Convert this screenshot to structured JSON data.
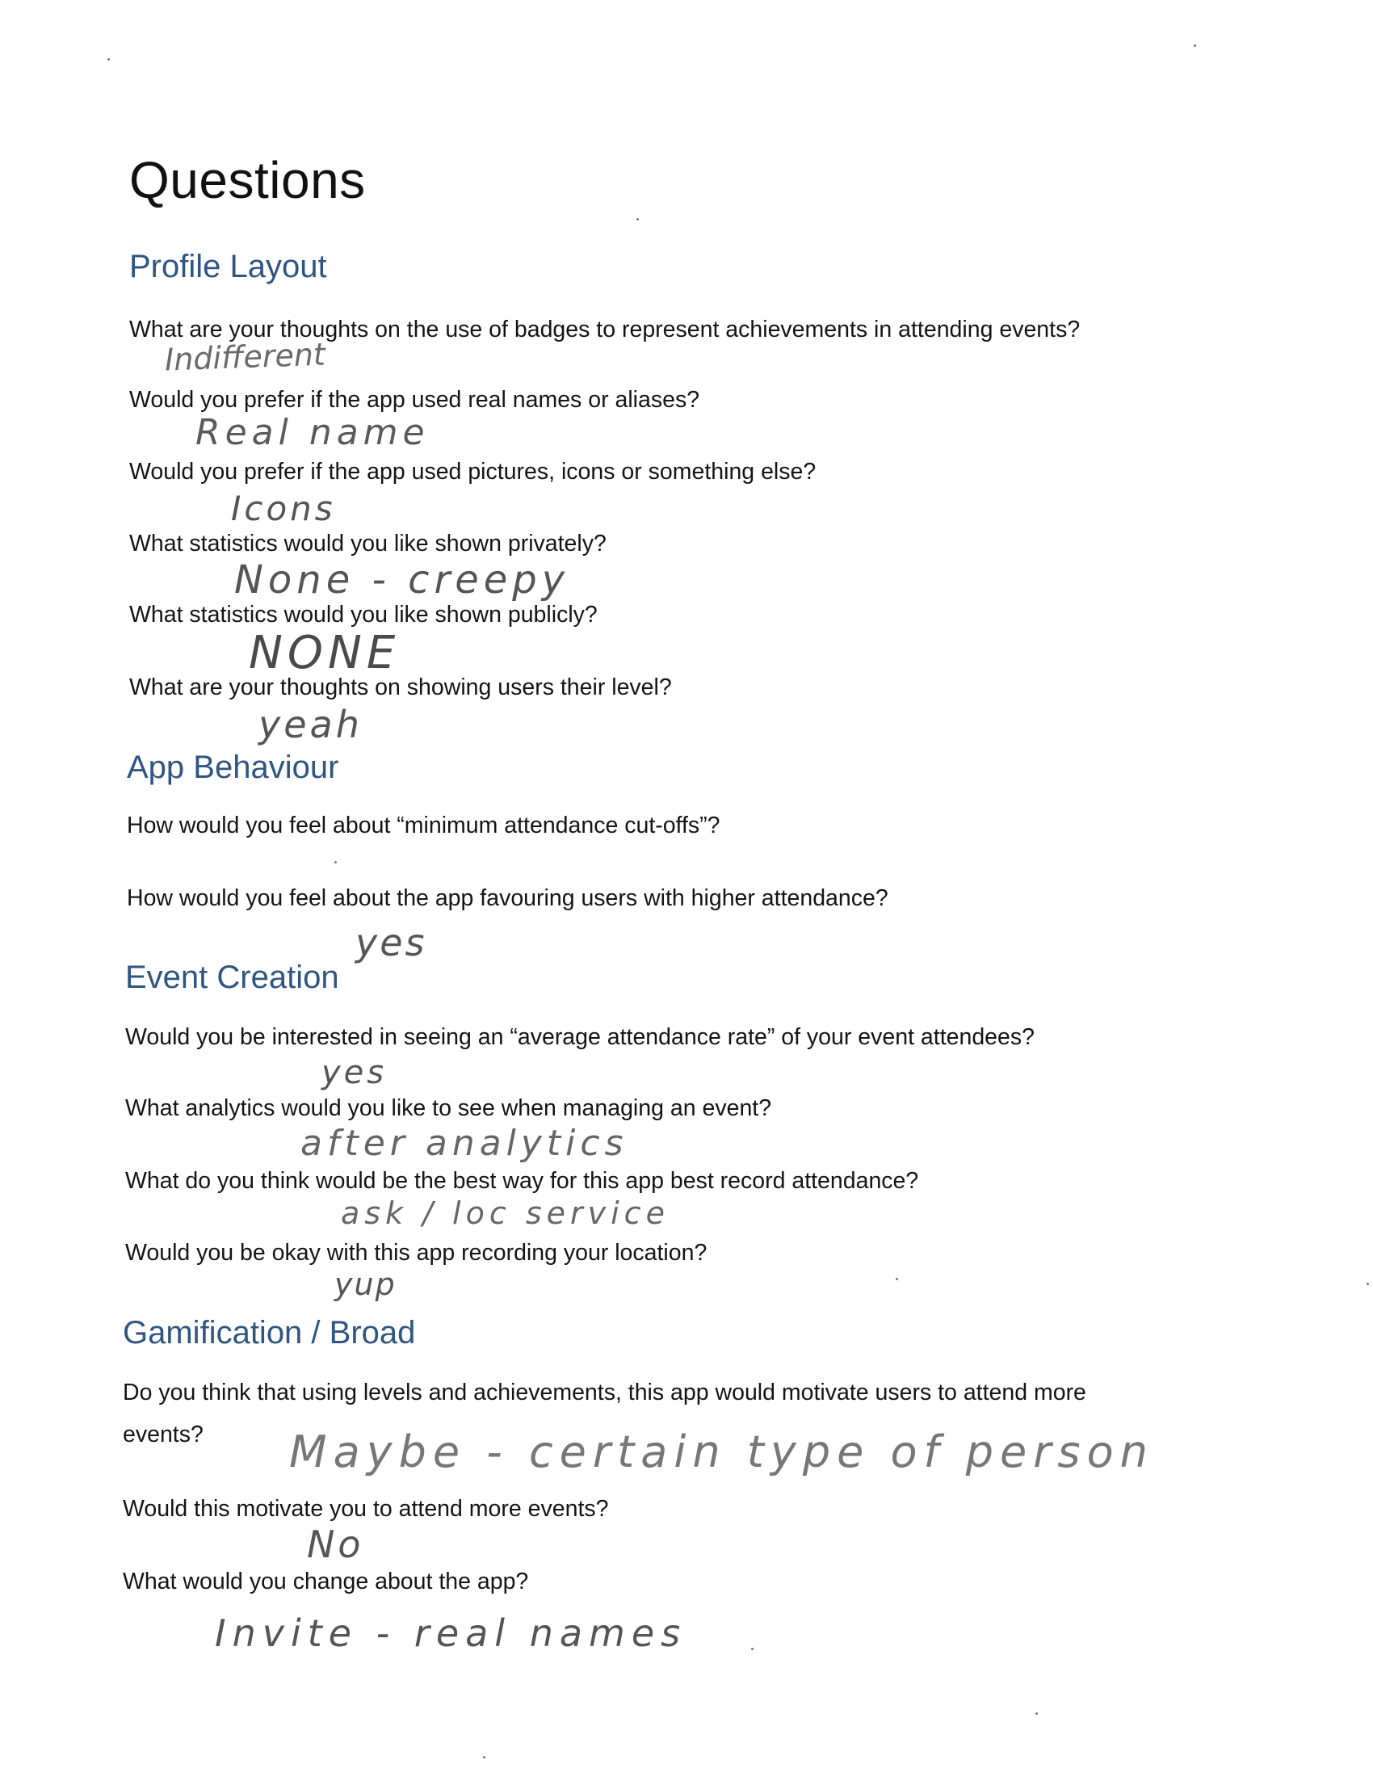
{
  "title": "Questions",
  "sections": [
    {
      "heading": "Profile Layout",
      "items": [
        {
          "q": "What are your thoughts on the use of badges to represent achievements in attending events?",
          "a": "Indifferent"
        },
        {
          "q": "Would you prefer if the app used real names or aliases?",
          "a": "Real name"
        },
        {
          "q": "Would you prefer if the app used pictures, icons or something else?",
          "a": "Icons"
        },
        {
          "q": "What statistics would you like shown privately?",
          "a": "None - creepy"
        },
        {
          "q": "What statistics would you like shown publicly?",
          "a": "NONE"
        },
        {
          "q": "What are your thoughts on showing users their level?",
          "a": "yeah"
        }
      ]
    },
    {
      "heading": "App Behaviour",
      "items": [
        {
          "q": "How would you feel about “minimum attendance cut-offs”?",
          "a": ""
        },
        {
          "q": "How would you feel about the app favouring users with higher attendance?",
          "a": "yes"
        }
      ]
    },
    {
      "heading": "Event Creation",
      "items": [
        {
          "q": "Would you be interested in seeing an “average attendance rate” of your event attendees?",
          "a": "yes"
        },
        {
          "q": "What analytics would you like to see when managing an event?",
          "a": "after analytics"
        },
        {
          "q": "What do you think would be the best way for this app best record attendance?",
          "a": "ask / loc service"
        },
        {
          "q": "Would you be okay with this app recording your location?",
          "a": "yup"
        }
      ]
    },
    {
      "heading": "Gamification / Broad",
      "items": [
        {
          "q": "Do you think that using levels and achievements, this app would motivate users to attend more",
          "q2": "events?",
          "a": "Maybe - certain type of person"
        },
        {
          "q": "Would this motivate you to attend more events?",
          "a": "No"
        },
        {
          "q": "What would you change about the app?",
          "a": "Invite - real names"
        }
      ]
    }
  ]
}
